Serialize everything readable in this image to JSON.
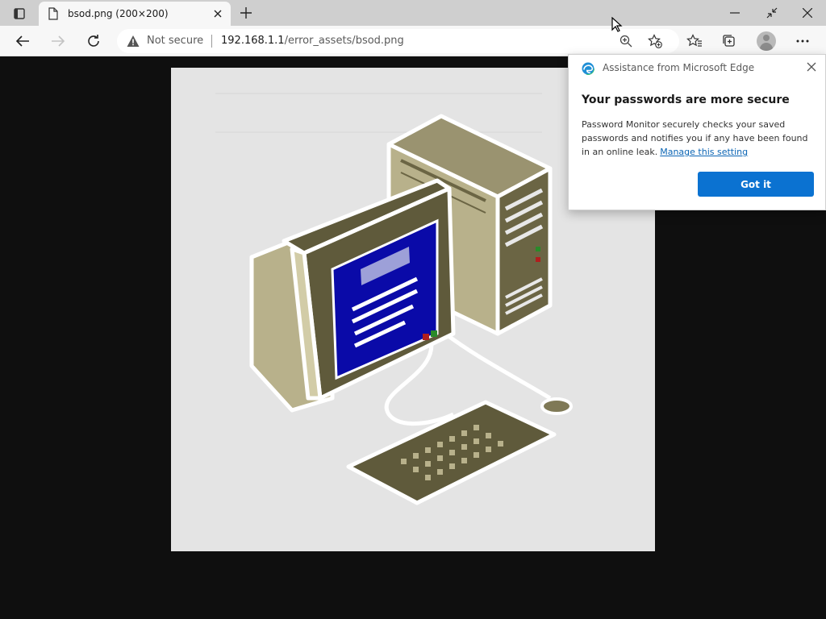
{
  "window": {
    "tab_title": "bsod.png (200×200)"
  },
  "toolbar": {
    "security_label": "Not secure",
    "url_host": "192.168.1.1",
    "url_path": "/error_assets/bsod.png"
  },
  "icons": {
    "tab_actions": "tab-actions-icon",
    "favicon": "document-icon",
    "close_tab": "close-icon",
    "new_tab": "plus-icon",
    "back": "back-arrow-icon",
    "forward": "forward-arrow-icon",
    "refresh": "refresh-icon",
    "warning": "warning-icon",
    "zoom": "zoom-in-icon",
    "add_favorite": "add-favorite-icon",
    "favorites": "favorites-icon",
    "collections": "collections-icon",
    "profile": "profile-icon",
    "more": "more-icon"
  },
  "popup": {
    "header": "Assistance from Microsoft Edge",
    "title": "Your passwords are more secure",
    "body": "Password Monitor securely checks your saved passwords and notifies you if any have been found in an online leak.",
    "link": "Manage this setting",
    "button": "Got it"
  },
  "colors": {
    "accent": "#0b72d1",
    "link": "#0a64b4",
    "viewer_background": "#0f0f0f",
    "monitor_screen": "#0a0aa8",
    "computer_body": "#b8b18b",
    "computer_dark": "#5f5a3b"
  }
}
